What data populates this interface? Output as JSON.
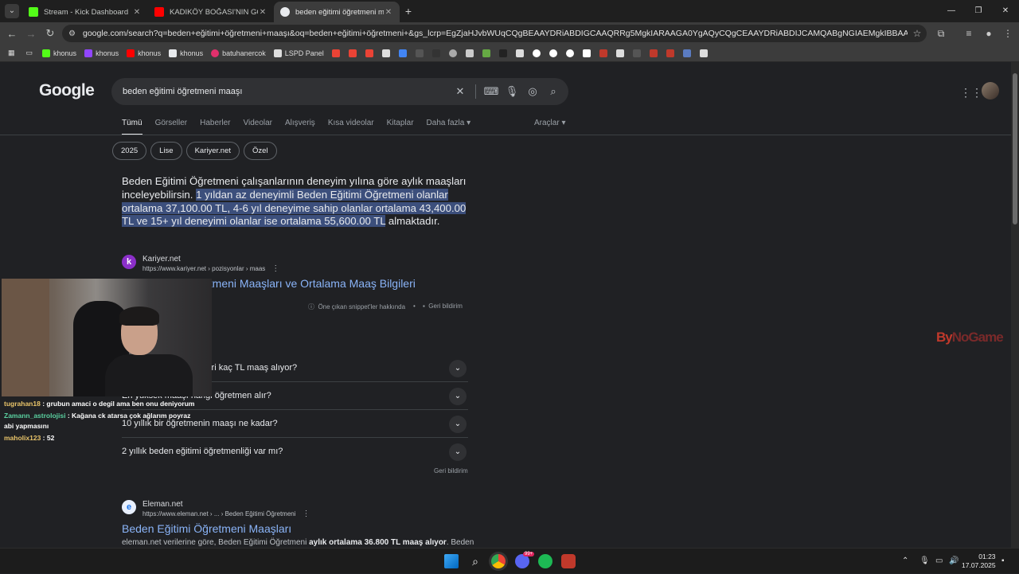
{
  "browser": {
    "tabs": [
      {
        "title": "Stream - Kick Dashboard",
        "color": "#53fc18"
      },
      {
        "title": "KADIKÖY BOĞASI'NIN GÖZÜNDEN",
        "color": "#ff0000"
      },
      {
        "title": "beden eğitimi öğretmeni maaşı",
        "color": "#e8eaed"
      }
    ],
    "url": "google.com/search?q=beden+eğitimi+öğretmeni+maaşı&oq=beden+eğitimi+öğretmeni+&gs_lcrp=EgZjaHJvbWUqCQgBEAAYDRiABDIGCAAQRRg5MgkIARAAGA0YgAQyCQgCEAAYDRiABDIJCAMQABgNGIAEMgkIBBAAGA0YgAQyCQgFEAAYDRiABA..."
  },
  "bookmarks": [
    {
      "label": "khonus",
      "color": "#53fc18"
    },
    {
      "label": "khonus",
      "color": "#9146ff"
    },
    {
      "label": "khonus",
      "color": "#ff0000"
    },
    {
      "label": "khonus",
      "color": "#e8eaed"
    },
    {
      "label": "batuhanercok",
      "color": "#e1306c"
    },
    {
      "label": "LSPD Panel",
      "color": "#dddddd"
    }
  ],
  "search": {
    "query": "beden eğitimi öğretmeni maaşı",
    "tabs": [
      "Tümü",
      "Görseller",
      "Haberler",
      "Videolar",
      "Alışveriş",
      "Kısa videolar",
      "Kitaplar",
      "Daha fazla ▾"
    ],
    "tools": "Araçlar ▾",
    "chips": [
      "2025",
      "Lise",
      "Kariyer.net",
      "Özel"
    ]
  },
  "snippet": {
    "plain1": "Beden Eğitimi Öğretmeni çalışanlarının deneyim yılına göre aylık maaşları inceleyebilirsin. ",
    "highlight": "1 yıldan az deneyimli Beden Eğitimi Öğretmeni olanlar ortalama 37,100.00 TL, 4-6 yıl deneyime sahip olanlar ortalama 43,400.00 TL ve 15+ yıl deneyimi olanlar ise ortalama 55,600.00 TL",
    "plain2": " almaktadır."
  },
  "result1": {
    "source": "Kariyer.net",
    "url": "https://www.kariyer.net › pozisyonlar › maas",
    "title": "etmeni Maaşları ve Ortalama Maaş Bilgileri",
    "about": "Öne çıkan snippet'ler hakkında",
    "feedback": "Geri bildirim"
  },
  "paa": [
    "leri kaç TL maaş alıyor?",
    "En yüksek maaşı hangi öğretmen alır?",
    "10 yıllık bir öğretmenin maaşı ne kadar?",
    "2 yıllık beden eğitimi öğretmenliği var mı?"
  ],
  "paa_feedback": "Geri bildirim",
  "result2": {
    "source": "Eleman.net",
    "url": "https://www.eleman.net › ... › Beden Eğitimi Öğretmeni",
    "title": "Beden Eğitimi Öğretmeni Maaşları",
    "desc_pre": "eleman.net verilerine göre, Beden Eğitimi Öğretmeni ",
    "desc_bold": "aylık ortalama 36.800 TL maaş alıyor",
    "desc_post": ". Beden"
  },
  "chat": [
    {
      "user": "tugrahan18",
      "msg": "grubun amaci o degil ama ben onu deniyorum"
    },
    {
      "user": "Zamann_astrolojisi",
      "msg": "Kağana ck atarsa çok ağlarım poyraz abi yapmasını"
    },
    {
      "user": "maholix123",
      "msg": "52"
    }
  ],
  "overlay": {
    "brand_a": "By",
    "brand_b": "NoGame"
  },
  "clock": {
    "time": "01:23",
    "date": "17.07.2025"
  },
  "discord_badge": "99+"
}
